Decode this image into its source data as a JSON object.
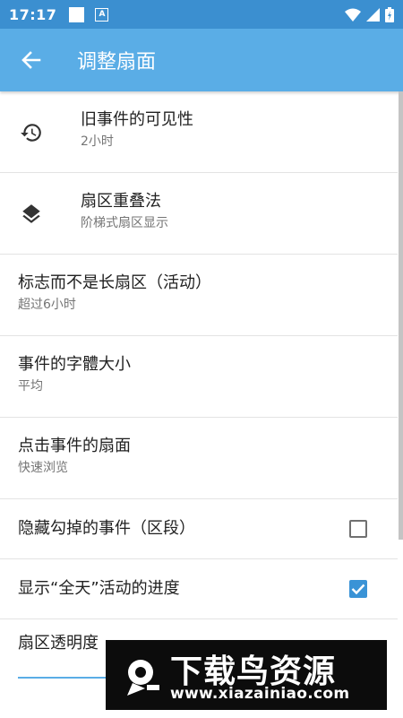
{
  "status_bar": {
    "time": "17:17",
    "notification_letter": "A"
  },
  "header": {
    "title": "调整扇面"
  },
  "settings": [
    {
      "title": "旧事件的可见性",
      "subtitle": "2小时",
      "icon": "history-icon"
    },
    {
      "title": "扇区重叠法",
      "subtitle": "阶梯式扇区显示",
      "icon": "layers-icon"
    },
    {
      "title": "标志而不是长扇区（活动）",
      "subtitle": "超过6小时"
    },
    {
      "title": "事件的字體大小",
      "subtitle": "平均"
    },
    {
      "title": "点击事件的扇面",
      "subtitle": "快速浏览"
    },
    {
      "title": "隐藏勾掉的事件（区段）",
      "checked": false
    },
    {
      "title": "显示“全天”活动的进度",
      "checked": true
    }
  ],
  "slider": {
    "title": "扇区透明度",
    "value_fraction": 0.3
  },
  "watermark": {
    "name": "下载鸟资源",
    "url": "www.xiazainiao.com"
  },
  "colors": {
    "status_bar": "#3b8fd0",
    "app_bar": "#5aade6",
    "checkbox_checked": "#3a93d6"
  }
}
